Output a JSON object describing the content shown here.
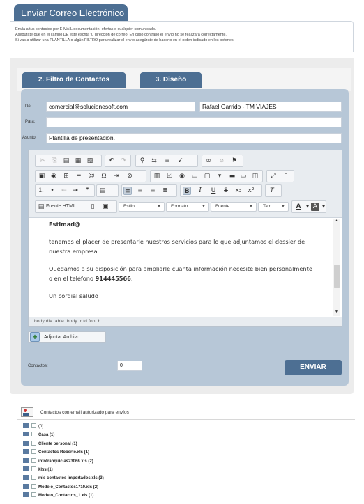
{
  "header": {
    "title": "Enviar Correo Electrónico"
  },
  "intro": {
    "line1": "Envía a tus contactos por E-MAIL documentación, ofertas o cualquier comunicado.",
    "line2": "Asegúrate que en el campo DE esté escrita tu dirección de correo. En caso contrario el envío no se realizará correctamente.",
    "line3": "Si vas a utilizar una PLANTILLA o algún FILTRO para realizar el envío asegúrate de hacerlo en el orden indicado en los botones"
  },
  "steps": {
    "filter": "2. Filtro de Contactos",
    "design": "3. Diseño"
  },
  "form": {
    "de_label": "De:",
    "de_email": "comercial@solucionesoft.com",
    "de_name": "Rafael Garrido - TM VIAJES",
    "para_label": "Para:",
    "para_value": "",
    "asunto_label": "Asunto:",
    "asunto_value": "Plantilla de presentacion."
  },
  "toolbar": {
    "source_label": "Fuente HTML",
    "style_label": "Estilo",
    "format_label": "Formato",
    "font_label": "Fuente",
    "size_label": "Tam...",
    "text_color_label": "A"
  },
  "document": {
    "greeting": "Estimad@",
    "para1": "tenemos el placer de presentarle nuestros servicios para lo que adjuntamos el dossier de nuestra empresa.",
    "para2_a": "Quedamos a su disposición para ampliarle cuanta información necesite bien personalmente o en el teléfono ",
    "para2_phone": "914445566",
    "para2_end": ".",
    "closing": "Un cordial saludo"
  },
  "path": "body div table tbody tr td font b",
  "attach_label": "Adjuntar Archivo",
  "contactos": {
    "label": "Contactos:",
    "value": "0"
  },
  "send_label": "ENVIAR",
  "list": {
    "title": "Contactos con email autorizado para envíos",
    "items": [
      {
        "name": "(0)",
        "bold": false
      },
      {
        "name": "Casa (1)",
        "bold": true
      },
      {
        "name": "Cliente personal (1)",
        "bold": true
      },
      {
        "name": "Contactos Roberto.xls (1)",
        "bold": true
      },
      {
        "name": "infofranquicias23066.xls (2)",
        "bold": true
      },
      {
        "name": "kiss (1)",
        "bold": true
      },
      {
        "name": "mis contactos importados.xls (3)",
        "bold": true
      },
      {
        "name": "Modelo_Contactos1710.xls (2)",
        "bold": true
      },
      {
        "name": "Modelo_Contactos_1.xls (1)",
        "bold": true
      }
    ]
  }
}
